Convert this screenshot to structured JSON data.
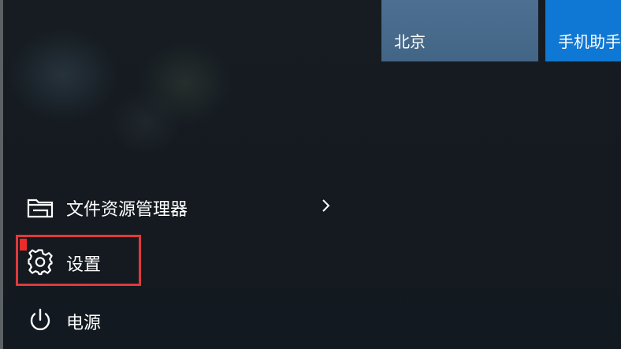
{
  "start_menu": {
    "items": [
      {
        "label": "文件资源管理器",
        "icon": "folder-icon",
        "has_submenu": true
      },
      {
        "label": "设置",
        "icon": "gear-icon"
      },
      {
        "label": "电源",
        "icon": "power-icon"
      }
    ]
  },
  "tiles": [
    {
      "label": "北京",
      "color": "#4a6c8e"
    },
    {
      "label": "手机助手",
      "color": "#0f78d4"
    }
  ],
  "annotation": {
    "highlight_color": "#e03a3a"
  }
}
